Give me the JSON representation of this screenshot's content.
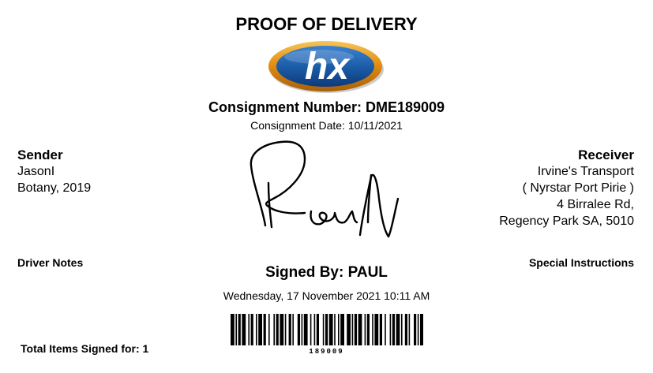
{
  "document": {
    "title": "PROOF OF DELIVERY",
    "logo_text": "hx",
    "consignment_number": "Consignment Number: DME189009",
    "consignment_date": "Consignment Date: 10/11/2021",
    "signed_by": "Signed By: PAUL",
    "signed_datetime": "Wednesday, 17 November 2021 10:11 AM",
    "barcode_number": "189009",
    "total_items": "Total Items Signed for: 1"
  },
  "sender": {
    "heading": "Sender",
    "lines": [
      "JasonI",
      "Botany, 2019"
    ]
  },
  "receiver": {
    "heading": "Receiver",
    "lines": [
      "Irvine's Transport",
      "( Nyrstar Port Pirie )",
      "4 Birralee Rd,",
      "Regency Park SA, 5010"
    ]
  },
  "notes": {
    "driver_notes_label": "Driver Notes",
    "special_instructions_label": "Special Instructions"
  },
  "colors": {
    "logo_blue": "#1a5aa6",
    "logo_orange": "#f0a020",
    "text": "#000000"
  }
}
